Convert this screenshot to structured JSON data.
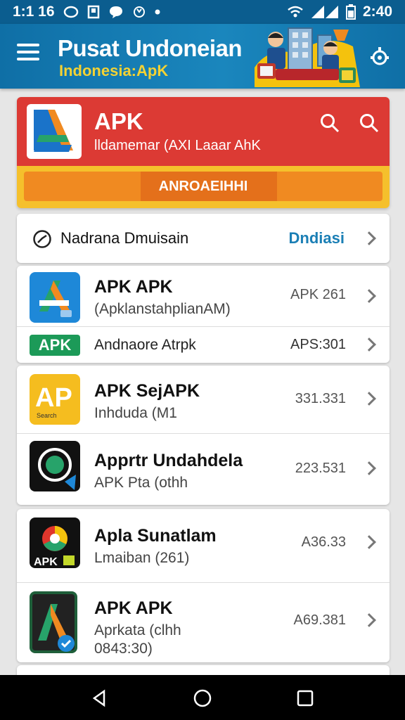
{
  "status_bar": {
    "time_left": "1:1 16",
    "time_right": "2:40"
  },
  "app_bar": {
    "title": "Pusat Undoneian",
    "subtitle": "Indonesia:ApK"
  },
  "header": {
    "title": "APK",
    "subtitle": "lldamemar (AXI Laaar AhK",
    "bar_label": "ANROAEIHHI"
  },
  "notice": {
    "label": "Nadrana Dmuisain",
    "action": "Dndiasi"
  },
  "apps": [
    {
      "title": "APK APK",
      "subtitle": "(ApklanstahplianAM)",
      "value": "APK 261"
    },
    {
      "badge": "APK",
      "subtitle": "Andnaore Atrpk",
      "value": "APS:301"
    },
    {
      "title": "APK SejAPK",
      "subtitle": "Inhduda (M1",
      "value": "331.331"
    },
    {
      "title": "Apprtr Undahdela",
      "subtitle": "APK Pta (othh",
      "value": "223.531"
    },
    {
      "title": "Apla Sunatlam",
      "subtitle": "Lmaiban (261)",
      "value": "A36.33"
    },
    {
      "title": "APK APK",
      "subtitle": "Aprkata (clhh",
      "subtitle2": "0843:30)",
      "value": "A69.381"
    }
  ],
  "icons": {
    "menu": "menu-icon",
    "settings": "settings-icon",
    "search": "search-icon",
    "chevron": "chevron-right-icon",
    "back": "back-icon",
    "home": "home-icon",
    "recents": "recents-icon"
  },
  "colors": {
    "app_bar": "#0f6fa6",
    "header_red": "#dc3a34",
    "header_yellow": "#f5c02c",
    "header_orange": "#f08a21",
    "action_blue": "#1b7fb5",
    "apk_badge": "#1c9a58"
  }
}
